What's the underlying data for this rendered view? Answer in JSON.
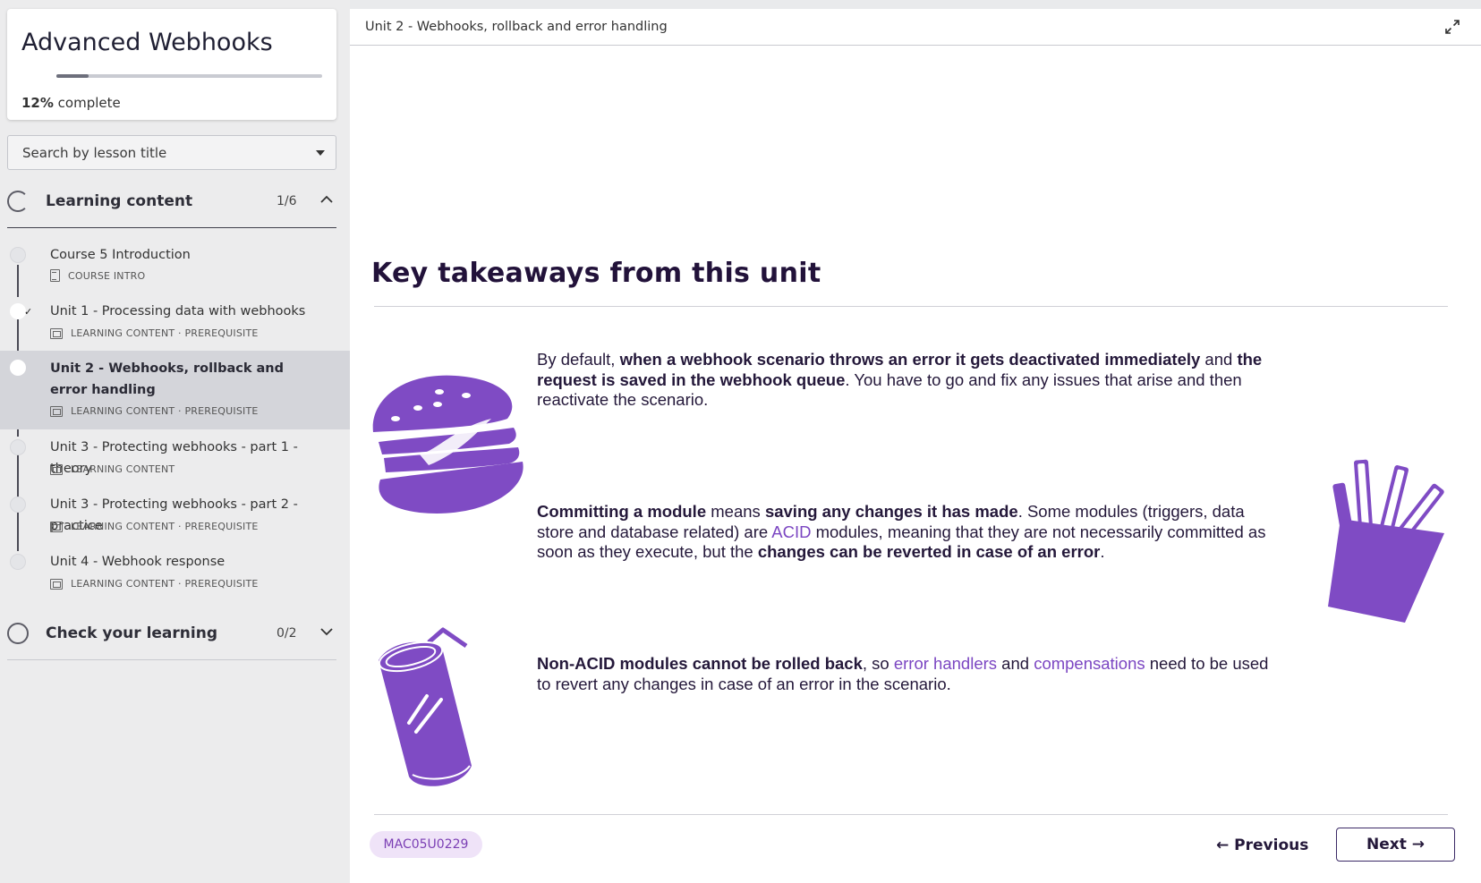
{
  "sidebar": {
    "course_title": "Advanced Webhooks",
    "progress_percent": 12,
    "progress_value": "12%",
    "progress_suffix": " complete",
    "search_placeholder": "Search by lesson title",
    "sections": [
      {
        "title": "Learning content",
        "count": "1/6",
        "expanded": true,
        "lessons": [
          {
            "title": "Course 5 Introduction",
            "meta": "COURSE INTRO",
            "icon": "document-icon",
            "status": "not-started"
          },
          {
            "title": "Unit 1 - Processing data with webhooks",
            "meta": "LEARNING CONTENT · PREREQUISITE",
            "icon": "slides-icon",
            "status": "completed"
          },
          {
            "title": "Unit 2 - Webhooks, rollback and error handling",
            "meta": "LEARNING CONTENT · PREREQUISITE",
            "icon": "slides-icon",
            "status": "current"
          },
          {
            "title": "Unit 3 - Protecting webhooks - part 1 - theory",
            "meta": "LEARNING CONTENT",
            "icon": "slides-icon",
            "status": "not-started"
          },
          {
            "title": "Unit 3 - Protecting webhooks - part 2 - practice",
            "meta": "LEARNING CONTENT · PREREQUISITE",
            "icon": "slides-icon",
            "status": "not-started"
          },
          {
            "title": "Unit 4 - Webhook response",
            "meta": "LEARNING CONTENT · PREREQUISITE",
            "icon": "slides-icon",
            "status": "not-started"
          }
        ]
      },
      {
        "title": "Check your learning",
        "count": "0/2",
        "expanded": false
      }
    ]
  },
  "main": {
    "unit_title": "Unit 2 - Webhooks, rollback and error handling",
    "heading": "Key takeaways from this unit",
    "paragraphs": [
      {
        "p1a": "By default, ",
        "p1b": "when a webhook scenario throws an error it gets deactivated immediately",
        "p1c": " and ",
        "p1d": "the request is saved in the webhook queue",
        "p1e": ". You have to go and fix any issues that arise and then reactivate the scenario."
      },
      {
        "p2a": "Committing a module",
        "p2b": " means ",
        "p2c": "saving any changes it has made",
        "p2d": ". Some modules (triggers, data store and database related) are ",
        "p2e": "ACID",
        "p2f": " modules, meaning that they are not necessarily committed as soon as they execute, but the ",
        "p2g": "changes can be reverted in case of an error",
        "p2h": "."
      },
      {
        "p3a": "Non-ACID modules cannot be rolled back",
        "p3b": ", so ",
        "p3c": "error handlers",
        "p3d": " and ",
        "p3e": "compensations",
        "p3f": " need to be used to revert any changes in case of an error in the scenario."
      }
    ],
    "lesson_code": "MAC05U0229",
    "prev_label": "← Previous",
    "next_label": "Next →"
  },
  "colors": {
    "accent": "#7f4bc4",
    "heading": "#22123a",
    "link": "#7b46c2",
    "badge_bg": "#efe3f8"
  }
}
